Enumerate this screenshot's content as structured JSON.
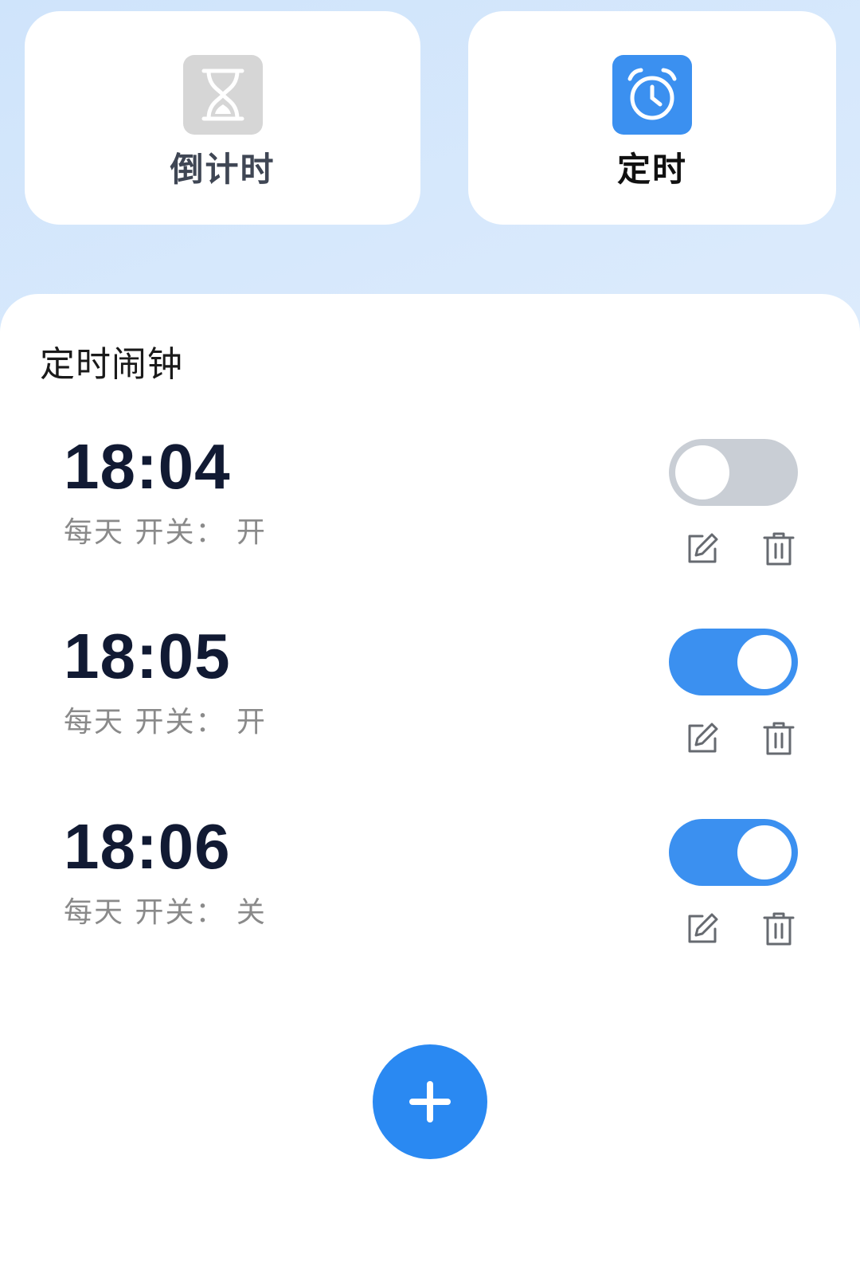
{
  "modes": [
    {
      "label": "倒计时",
      "icon": "hourglass-icon",
      "selected": false,
      "icon_bg": "#d6d6d6"
    },
    {
      "label": "定时",
      "icon": "alarm-clock-icon",
      "selected": true,
      "icon_bg": "#3b90f0"
    }
  ],
  "panel": {
    "title": "定时闹钟"
  },
  "alarms": [
    {
      "time": "18:04",
      "repeat": "每天",
      "status_label": "开关",
      "status_value": "开",
      "subtitle": "每天 开关： 开",
      "toggle_on": false
    },
    {
      "time": "18:05",
      "repeat": "每天",
      "status_label": "开关",
      "status_value": "开",
      "subtitle": "每天 开关： 开",
      "toggle_on": true
    },
    {
      "time": "18:06",
      "repeat": "每天",
      "status_label": "开关",
      "status_value": "关",
      "subtitle": "每天 开关： 关",
      "toggle_on": true
    }
  ],
  "row_icons": {
    "edit": "edit-icon",
    "delete": "trash-icon"
  },
  "fab": {
    "icon": "plus-icon"
  },
  "colors": {
    "accent": "#3b90f0",
    "toggle_off": "#c9ced5",
    "time_text": "#111a33",
    "sub_text": "#8a8a8a",
    "background_gradient": "#cfe4fb"
  }
}
